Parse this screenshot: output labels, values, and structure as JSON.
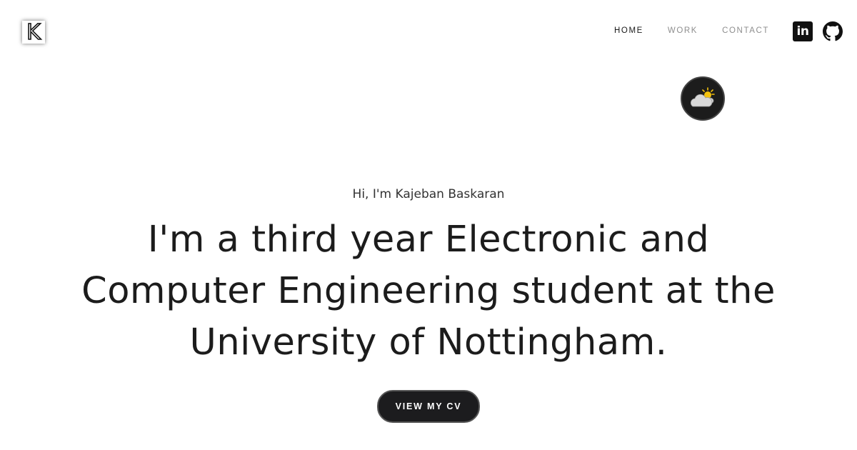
{
  "header": {
    "logo_letter": "K",
    "logo_icon": "k-monogram-logo",
    "nav": [
      {
        "label": "HOME",
        "active": true
      },
      {
        "label": "WORK",
        "active": false
      },
      {
        "label": "CONTACT",
        "active": false
      }
    ],
    "social": [
      {
        "icon": "linkedin-icon",
        "label": "in"
      },
      {
        "icon": "github-icon"
      }
    ]
  },
  "theme_toggle": {
    "icon": "cloud-sun-icon"
  },
  "hero": {
    "greeting": "Hi, I'm Kajeban Baskaran",
    "headline": "I'm a third year Electronic and Computer Engineering student at the University of Nottingham.",
    "cta_label": "VIEW MY CV"
  },
  "colors": {
    "background": "#ffffff",
    "text": "#1c1c1c",
    "nav_inactive": "#8e8e8e",
    "button_bg": "#1c1c1e",
    "sun": "#f4c20d"
  }
}
